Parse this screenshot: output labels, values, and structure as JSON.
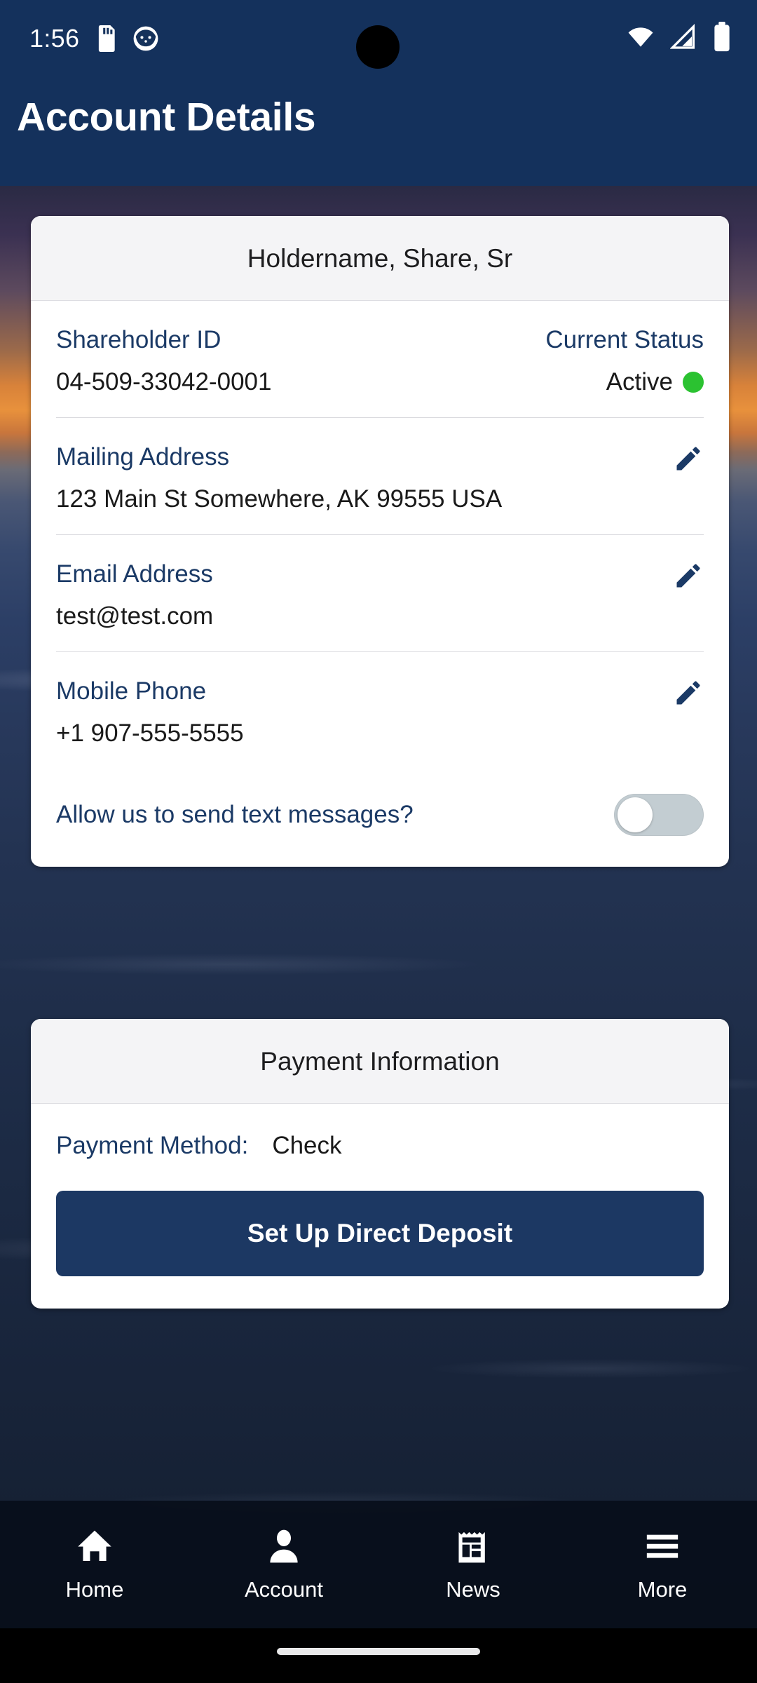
{
  "status_bar": {
    "time": "1:56",
    "icons_left": [
      "sd-card-icon",
      "app-notification-icon"
    ],
    "icons_right": [
      "wifi-icon",
      "cellular-signal-icon",
      "battery-icon"
    ]
  },
  "app_bar": {
    "title": "Account Details",
    "background": "#14315c"
  },
  "account_card": {
    "header": "Holdername, Share, Sr",
    "shareholder": {
      "label": "Shareholder ID",
      "value": "04-509-33042-0001"
    },
    "status": {
      "label": "Current Status",
      "value": "Active",
      "dot_color": "#2bc231"
    },
    "mailing_address": {
      "label": "Mailing Address",
      "value": "123 Main St Somewhere, AK 99555 USA",
      "edit_icon": "pencil-icon"
    },
    "email": {
      "label": "Email Address",
      "value": "test@test.com",
      "edit_icon": "pencil-icon"
    },
    "mobile_phone": {
      "label": "Mobile Phone",
      "value": "+1 907-555-5555",
      "edit_icon": "pencil-icon"
    },
    "text_messages": {
      "label": "Allow us to send text messages?",
      "enabled": false
    }
  },
  "payment_card": {
    "header": "Payment Information",
    "method_label": "Payment Method:",
    "method_value": "Check",
    "button_label": "Set Up Direct Deposit",
    "button_color": "#1c3863"
  },
  "bottom_nav": {
    "items": [
      {
        "label": "Home",
        "icon": "home-icon"
      },
      {
        "label": "Account",
        "icon": "person-icon"
      },
      {
        "label": "News",
        "icon": "newspaper-icon"
      },
      {
        "label": "More",
        "icon": "hamburger-menu-icon"
      }
    ]
  }
}
